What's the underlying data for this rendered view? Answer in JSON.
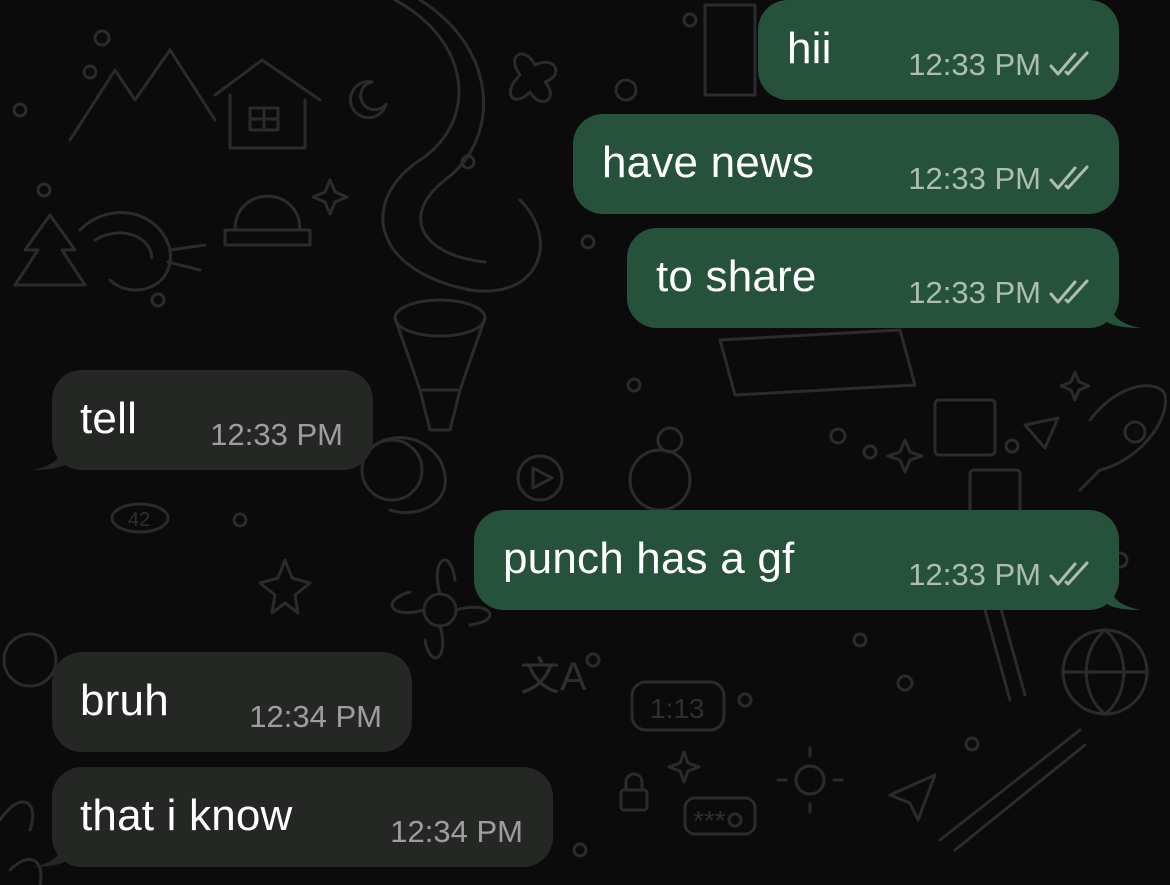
{
  "colors": {
    "background": "#0b0b0b",
    "outgoing_bubble": "#26513a",
    "incoming_bubble": "#252725",
    "message_text": "#ffffff",
    "timestamp": "#a9b7ae"
  },
  "messages": [
    {
      "direction": "outgoing",
      "text": "hii",
      "time": "12:33 PM",
      "status_icon": "double-check-icon"
    },
    {
      "direction": "outgoing",
      "text": "have news",
      "time": "12:33 PM",
      "status_icon": "double-check-icon"
    },
    {
      "direction": "outgoing",
      "text": "to share",
      "time": "12:33 PM",
      "status_icon": "double-check-icon"
    },
    {
      "direction": "incoming",
      "text": "tell",
      "time": "12:33 PM"
    },
    {
      "direction": "outgoing",
      "text": "punch has a gf",
      "time": "12:33 PM",
      "status_icon": "double-check-icon"
    },
    {
      "direction": "incoming",
      "text": "bruh",
      "time": "12:34 PM"
    },
    {
      "direction": "incoming",
      "text": "that i know",
      "time": "12:34 PM"
    }
  ],
  "wallpaper": {
    "doodles": [
      "house-doodle",
      "moon-doodle",
      "shrimp-doodle",
      "flower-doodle",
      "sparkle-doodle",
      "clock-doodle",
      "globe-doodle",
      "paper-plane-doodle",
      "drum-doodle",
      "rocket-doodle"
    ],
    "clock_text": "1:13",
    "kanji_text": "文A",
    "password_text": "***",
    "badge_text": "42"
  }
}
